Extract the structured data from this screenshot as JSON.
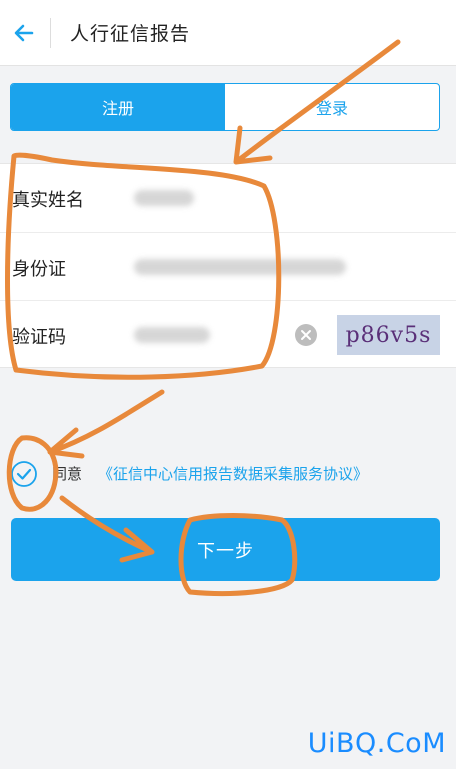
{
  "header": {
    "title": "人行征信报告"
  },
  "tabs": [
    {
      "label": "注册",
      "active": true
    },
    {
      "label": "登录",
      "active": false
    }
  ],
  "form": {
    "fields": [
      {
        "label": "真实姓名"
      },
      {
        "label": "身份证"
      },
      {
        "label": "验证码"
      }
    ],
    "captcha": "p86v5s"
  },
  "agreement": {
    "prefix": "同意",
    "link": "《征信中心信用报告数据采集服务协议》",
    "checked": true
  },
  "next_button": {
    "label": "下一步"
  },
  "watermark": "UiBQ.CoM",
  "colors": {
    "accent": "#1ba3ec",
    "annotation": "#e8893b",
    "watermark": "#1a8cff"
  }
}
